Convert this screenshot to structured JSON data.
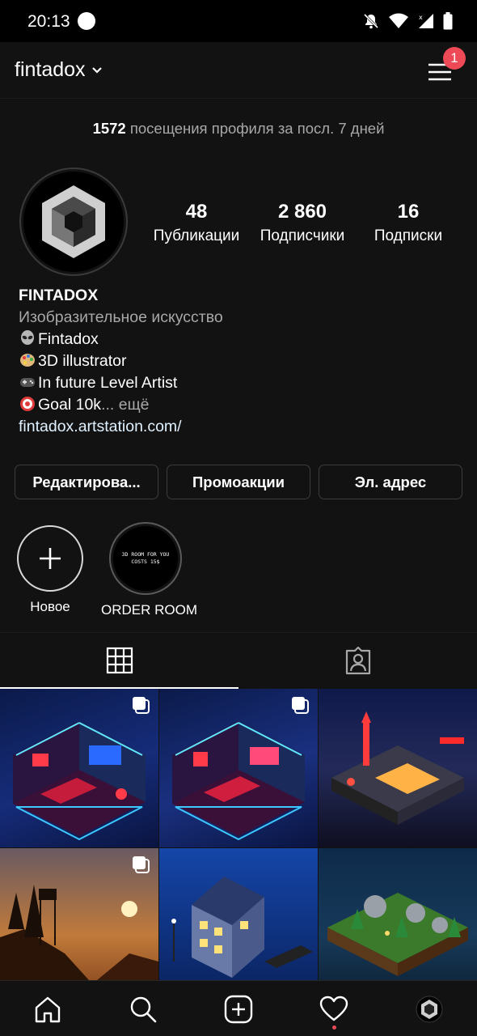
{
  "status_bar": {
    "time": "20:13"
  },
  "header": {
    "username": "fintadox",
    "menu_badge": "1"
  },
  "profile_visits": {
    "count": "1572",
    "text": "посещения профиля за посл. 7 дней"
  },
  "stats": [
    {
      "value": "48",
      "label": "Публикации"
    },
    {
      "value": "2 860",
      "label": "Подписчики"
    },
    {
      "value": "16",
      "label": "Подписки"
    }
  ],
  "bio": {
    "name": "FINTADOX",
    "category": "Изобразительное искусство",
    "lines": [
      "Fintadox",
      "3D illustrator",
      "In future Level Artist",
      "Goal 10k"
    ],
    "more": "... ещё",
    "link": "fintadox.artstation.com/"
  },
  "buttons": {
    "edit": "Редактирова...",
    "promotions": "Промоакции",
    "email": "Эл. адрес"
  },
  "highlights": [
    {
      "label": "Новое"
    },
    {
      "label": "ORDER ROOM",
      "cover_text": "3D ROOM FOR YOU COSTS 15$"
    }
  ],
  "icons": {
    "tabs": [
      "grid-icon",
      "tagged-icon"
    ],
    "nav": [
      "home-icon",
      "search-icon",
      "new-post-icon",
      "activity-heart-icon",
      "profile-avatar-icon"
    ]
  },
  "colors": {
    "background": "#121212",
    "badge": "#ed4956",
    "muted_text": "#a8a8a8",
    "link": "#e0f1ff"
  }
}
